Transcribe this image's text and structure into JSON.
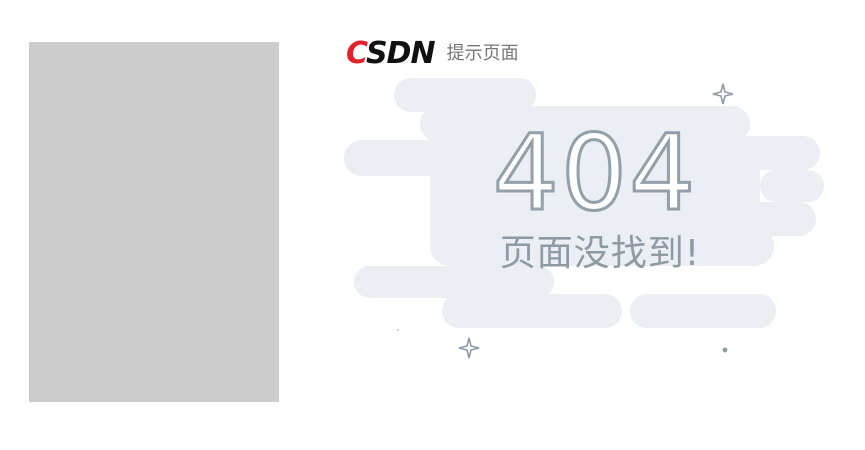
{
  "brand": {
    "logo_text": "CSDN",
    "caption": "提示页面"
  },
  "error": {
    "code": "404",
    "message": "页面没找到!"
  },
  "icons": {
    "sparkle": "sparkle-icon",
    "dot": "dot-icon"
  },
  "colors": {
    "placeholder": "#cccccc",
    "cloud": "#ebeef2",
    "outline": "#93a0aa",
    "brand_red": "#e4202a"
  }
}
